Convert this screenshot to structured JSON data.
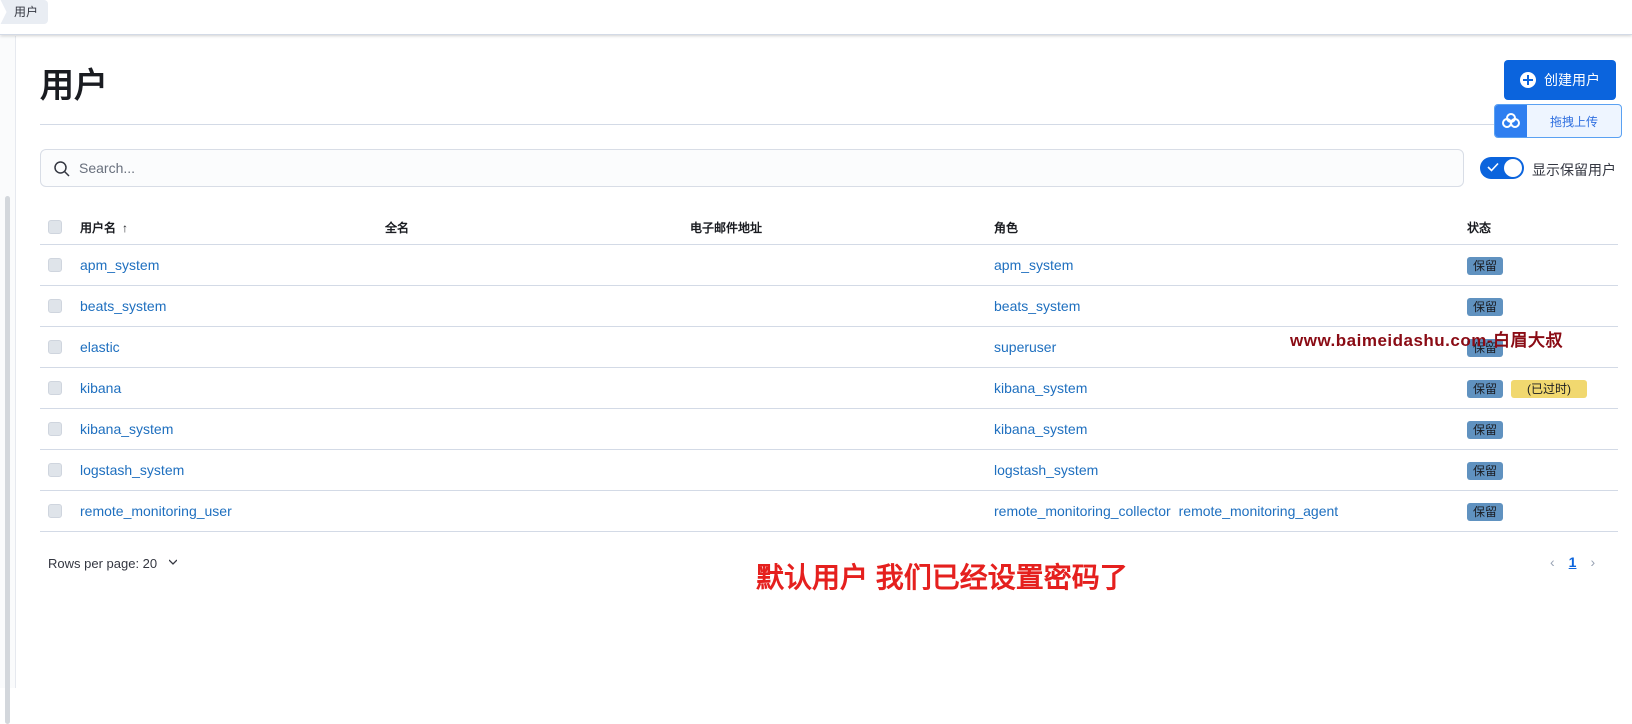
{
  "breadcrumb": {
    "current": "用户"
  },
  "page": {
    "title": "用户"
  },
  "actions": {
    "create_user": "创建用户",
    "drag_upload": "拖拽上传"
  },
  "search": {
    "placeholder": "Search..."
  },
  "toggle": {
    "label": "显示保留用户",
    "checked": true
  },
  "table": {
    "headers": {
      "username": "用户名",
      "fullname": "全名",
      "email": "电子邮件地址",
      "roles": "角色",
      "status": "状态"
    },
    "sort": {
      "column": "用户名",
      "direction": "ascending"
    },
    "rows": [
      {
        "username": "apm_system",
        "fullname": "",
        "email": "",
        "roles": [
          "apm_system"
        ],
        "badges": [
          "保留"
        ]
      },
      {
        "username": "beats_system",
        "fullname": "",
        "email": "",
        "roles": [
          "beats_system"
        ],
        "badges": [
          "保留"
        ]
      },
      {
        "username": "elastic",
        "fullname": "",
        "email": "",
        "roles": [
          "superuser"
        ],
        "badges": [
          "保留"
        ]
      },
      {
        "username": "kibana",
        "fullname": "",
        "email": "",
        "roles": [
          "kibana_system"
        ],
        "badges": [
          "保留",
          "(已过时)"
        ]
      },
      {
        "username": "kibana_system",
        "fullname": "",
        "email": "",
        "roles": [
          "kibana_system"
        ],
        "badges": [
          "保留"
        ]
      },
      {
        "username": "logstash_system",
        "fullname": "",
        "email": "",
        "roles": [
          "logstash_system"
        ],
        "badges": [
          "保留"
        ]
      },
      {
        "username": "remote_monitoring_user",
        "fullname": "",
        "email": "",
        "roles": [
          "remote_monitoring_collector",
          "remote_monitoring_agent"
        ],
        "badges": [
          "保留"
        ]
      }
    ]
  },
  "pagination": {
    "rows_per_page": "Rows per page: 20",
    "current_page": "1"
  },
  "overlay": {
    "annotation": "默认用户 我们已经设置密码了",
    "watermark": "www.baimeidashu.com-白眉大叔"
  },
  "colors": {
    "primary": "#0b64dd",
    "link": "#1e6fbf",
    "badge_reserved": "#6092c0",
    "badge_deprecated": "#f1d86f",
    "annotation": "#e5201e",
    "watermark": "#8a0b14"
  }
}
